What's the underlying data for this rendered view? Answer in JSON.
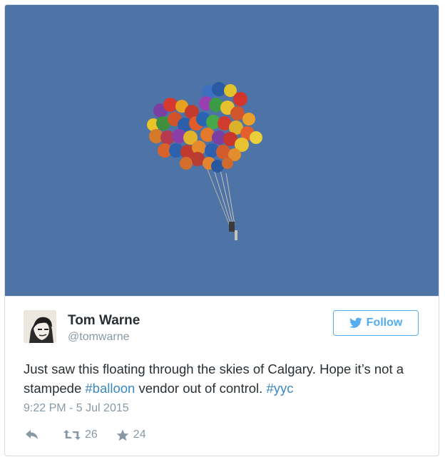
{
  "photo": {
    "sky_color": "#4e73a6"
  },
  "author": {
    "name": "Tom Warne",
    "handle": "@tomwarne"
  },
  "follow_button": {
    "label": "Follow",
    "color": "#55acee"
  },
  "tweet": {
    "text_1": "Just saw this floating through the skies of Calgary. Hope it’s not a stampede ",
    "hashtag_1": "#balloon",
    "text_2": " vendor out of control. ",
    "hashtag_2": "#yyc",
    "timestamp": "9:22 PM - 5 Jul 2015"
  },
  "actions": {
    "reply_icon": "reply-icon",
    "retweet_icon": "retweet-icon",
    "retweet_count": "26",
    "favorite_icon": "star-icon",
    "favorite_count": "24"
  }
}
